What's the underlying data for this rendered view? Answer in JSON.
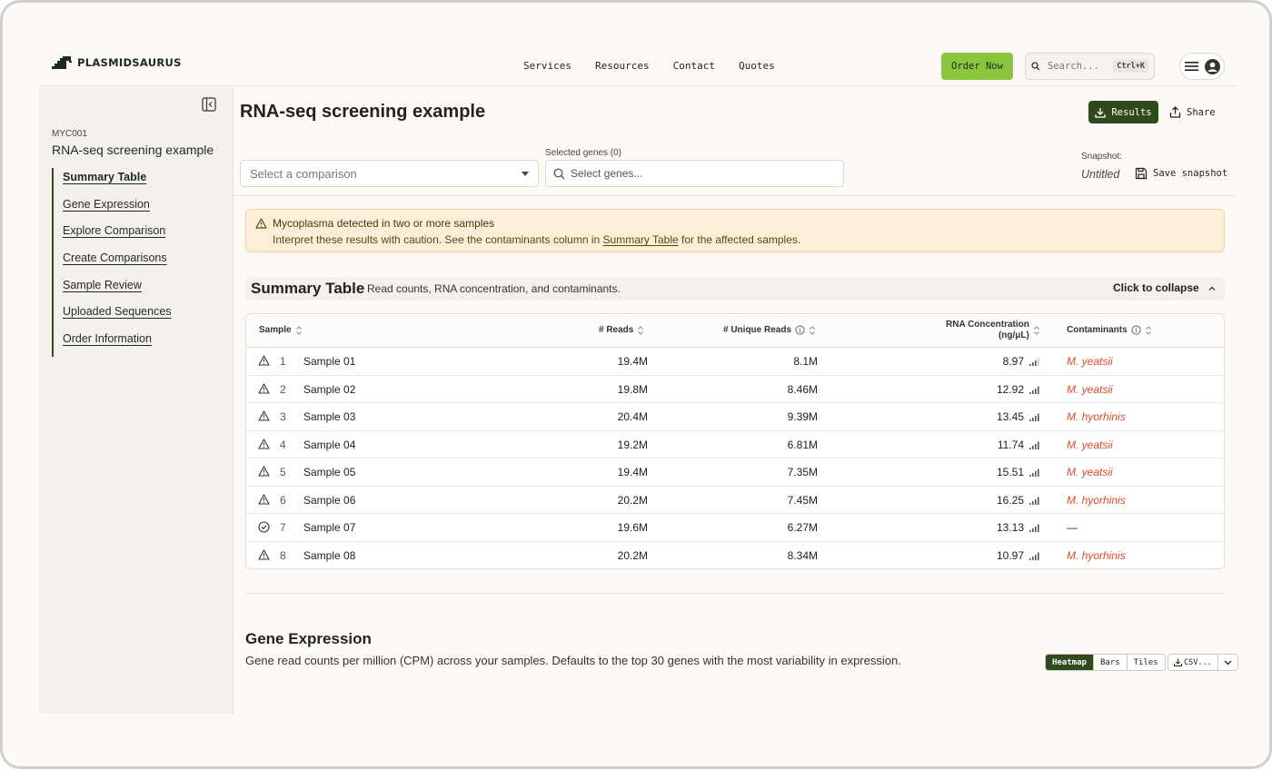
{
  "header": {
    "brand": "PLASMIDSAURUS",
    "nav": [
      "Services",
      "Resources",
      "Contact",
      "Quotes"
    ],
    "order_label": "Order Now",
    "search_placeholder": "Search...",
    "search_shortcut": "Ctrl+K",
    "brand_color": "#8cc63f"
  },
  "sidebar": {
    "project_code": "MYC001",
    "project_title": "RNA-seq screening example",
    "items": [
      {
        "label": "Summary Table",
        "active": true
      },
      {
        "label": "Gene Expression"
      },
      {
        "label": "Explore Comparison"
      },
      {
        "label": "Create Comparisons"
      },
      {
        "label": "Sample Review"
      },
      {
        "label": "Uploaded Sequences"
      },
      {
        "label": "Order Information"
      }
    ]
  },
  "main": {
    "title": "RNA-seq screening example",
    "results_label": "Results",
    "share_label": "Share",
    "comparison_placeholder": "Select a comparison",
    "genes_label": "Selected genes (0)",
    "genes_placeholder": "Select genes...",
    "snapshot_label": "Snapshot:",
    "snapshot_name": "Untitled",
    "save_snapshot_label": "Save snapshot"
  },
  "alert": {
    "title": "Mycoplasma detected in two or more samples",
    "body_prefix": "Interpret these results with caution. See the contaminants column in ",
    "body_link": "Summary Table",
    "body_suffix": " for the affected samples."
  },
  "summary": {
    "title": "Summary Table",
    "subtitle": "Read counts, RNA concentration, and contaminants.",
    "collapse_label": "Click to collapse",
    "columns": {
      "sample": "Sample",
      "reads": "# Reads",
      "unique": "# Unique Reads",
      "rna_1": "RNA Concentration",
      "rna_2": "(ng/μL)",
      "contam": "Contaminants"
    },
    "rows": [
      {
        "status": "warning",
        "index": "1",
        "name": "Sample 01",
        "reads": "19.4M",
        "unique": "8.1M",
        "rna": "8.97",
        "contam": "M. yeatsii"
      },
      {
        "status": "warning",
        "index": "2",
        "name": "Sample 02",
        "reads": "19.8M",
        "unique": "8.46M",
        "rna": "12.92",
        "contam": "M. yeatsii"
      },
      {
        "status": "warning",
        "index": "3",
        "name": "Sample 03",
        "reads": "20.4M",
        "unique": "9.39M",
        "rna": "13.45",
        "contam": "M. hyorhinis"
      },
      {
        "status": "warning",
        "index": "4",
        "name": "Sample 04",
        "reads": "19.2M",
        "unique": "6.81M",
        "rna": "11.74",
        "contam": "M. yeatsii"
      },
      {
        "status": "warning",
        "index": "5",
        "name": "Sample 05",
        "reads": "19.4M",
        "unique": "7.35M",
        "rna": "15.51",
        "contam": "M. yeatsii"
      },
      {
        "status": "warning",
        "index": "6",
        "name": "Sample 06",
        "reads": "20.2M",
        "unique": "7.45M",
        "rna": "16.25",
        "contam": "M. hyorhinis"
      },
      {
        "status": "ok",
        "index": "7",
        "name": "Sample 07",
        "reads": "19.6M",
        "unique": "6.27M",
        "rna": "13.13",
        "contam": "—"
      },
      {
        "status": "warning",
        "index": "8",
        "name": "Sample 08",
        "reads": "20.2M",
        "unique": "8.34M",
        "rna": "10.97",
        "contam": "M. hyorhinis"
      }
    ]
  },
  "gene_expression": {
    "title": "Gene Expression",
    "subtitle": "Gene read counts per million (CPM) across your samples. Defaults to the top 30 genes with the most variability in expression.",
    "views": [
      "Heatmap",
      "Bars",
      "Tiles"
    ],
    "active_view": "Heatmap",
    "csv_label": "CSV..."
  }
}
